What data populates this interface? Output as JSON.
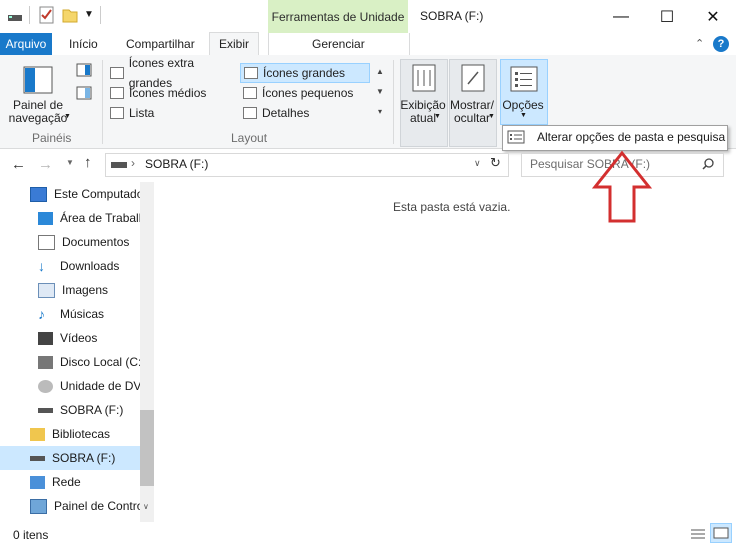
{
  "window": {
    "title": "SOBRA (F:)",
    "context_tab_group": "Ferramentas de Unidade",
    "min_glyph": "—",
    "max_glyph": "☐",
    "close_glyph": "✕"
  },
  "tabs": {
    "file": "Arquivo",
    "home": "Início",
    "share": "Compartilhar",
    "view": "Exibir",
    "manage": "Gerenciar"
  },
  "ribbon": {
    "panels": {
      "nav_pane_label": "Painel de\nnavegação",
      "group_label": "Painéis"
    },
    "layout": {
      "items": [
        "Ícones extra grandes",
        "Ícones médios",
        "Lista",
        "Ícones grandes",
        "Ícones pequenos",
        "Detalhes"
      ],
      "selected": "Ícones grandes",
      "group_label": "Layout"
    },
    "current_view_label": "Exibição\natual",
    "show_hide_label": "Mostrar/\nocultar",
    "options_label": "Opções"
  },
  "options_menu": {
    "item": "Alterar opções de pasta e pesquisa"
  },
  "address": {
    "path": "SOBRA (F:)",
    "search_placeholder": "Pesquisar SOBRA (F:)"
  },
  "nav_items": [
    {
      "label": "Este Computador",
      "icon": "computer-icon",
      "level": 1
    },
    {
      "label": "Área de Trabalho",
      "icon": "desktop-icon",
      "level": 2
    },
    {
      "label": "Documentos",
      "icon": "documents-icon",
      "level": 2
    },
    {
      "label": "Downloads",
      "icon": "downloads-icon",
      "level": 2
    },
    {
      "label": "Imagens",
      "icon": "pictures-icon",
      "level": 2
    },
    {
      "label": "Músicas",
      "icon": "music-icon",
      "level": 2
    },
    {
      "label": "Vídeos",
      "icon": "videos-icon",
      "level": 2
    },
    {
      "label": "Disco Local (C:)",
      "icon": "local-disk-icon",
      "level": 2
    },
    {
      "label": "Unidade de DVD",
      "icon": "dvd-drive-icon",
      "level": 2
    },
    {
      "label": "SOBRA (F:)",
      "icon": "usb-drive-icon",
      "level": 2
    },
    {
      "label": "Bibliotecas",
      "icon": "libraries-icon",
      "level": 1
    },
    {
      "label": "SOBRA (F:)",
      "icon": "usb-drive-icon",
      "level": 1,
      "selected": true
    },
    {
      "label": "Rede",
      "icon": "network-icon",
      "level": 1
    },
    {
      "label": "Painel de Controle",
      "icon": "control-panel-icon",
      "level": 1
    }
  ],
  "content": {
    "empty_message": "Esta pasta está vazia."
  },
  "status": {
    "items_count": "0 itens"
  },
  "colors": {
    "accent": "#1979ca",
    "context_tab": "#d9f0c5",
    "selection": "#cce8ff",
    "arrow": "#d32f2f"
  }
}
